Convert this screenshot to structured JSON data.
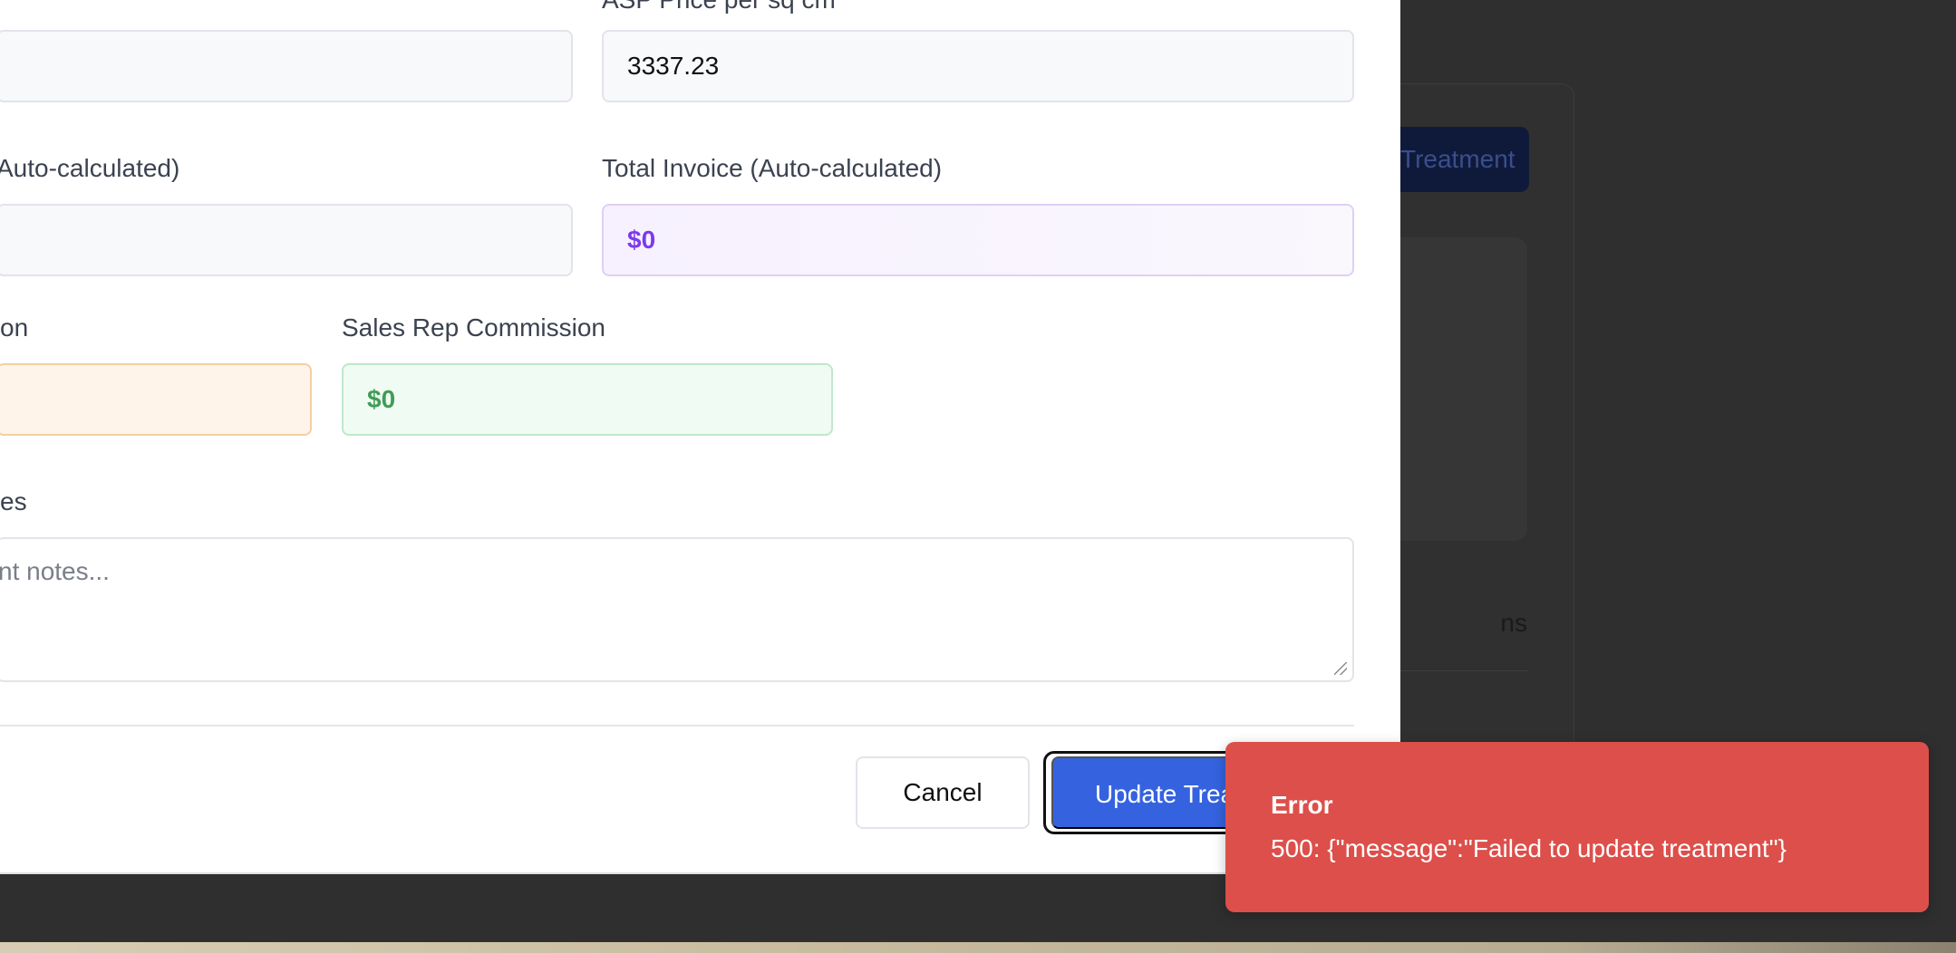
{
  "background_app": {
    "button_label": "Treatment",
    "tab_label": "ns"
  },
  "form": {
    "asp_price_label": "ASP Price per sq cm",
    "asp_price_value": "3337.23",
    "left_calc_label": "Auto-calculated)",
    "total_invoice_label": "Total Invoice (Auto-calculated)",
    "total_invoice_value": "$0",
    "left_commission_label": "on",
    "sales_rep_commission_label": "Sales Rep Commission",
    "sales_rep_commission_value": "$0",
    "notes_label": "es",
    "notes_placeholder": "nt notes..."
  },
  "actions": {
    "cancel_label": "Cancel",
    "update_label": "Update Treatment"
  },
  "toast": {
    "title": "Error",
    "message": "500: {\"message\":\"Failed to update treatment\"}"
  },
  "colors": {
    "primary": "#3563e0",
    "error": "#dd4f4a",
    "invoice_text": "#7c3aed",
    "commission_text": "#3f9d55"
  }
}
